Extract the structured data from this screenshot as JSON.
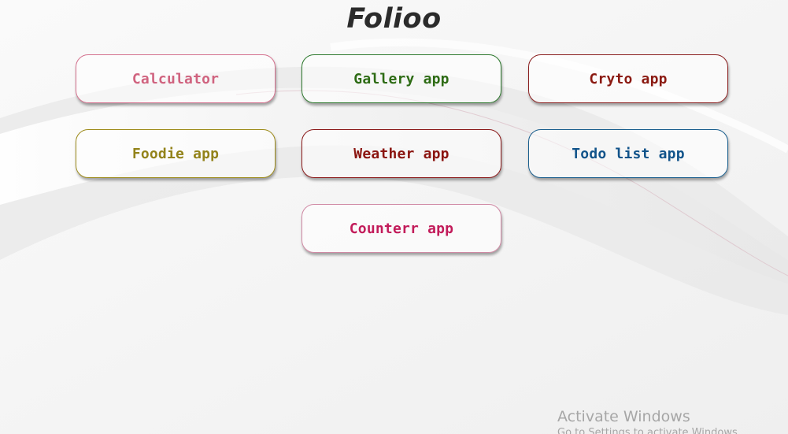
{
  "page": {
    "title": "Folioo"
  },
  "apps": [
    {
      "label": "Calculator",
      "color": "#d0637f"
    },
    {
      "label": "Gallery app",
      "color": "#2d6b14"
    },
    {
      "label": "Cryto app",
      "color": "#8b1a12"
    },
    {
      "label": "Foodie app",
      "color": "#93831a"
    },
    {
      "label": "Weather app",
      "color": "#8b1510"
    },
    {
      "label": "Todo list app",
      "color": "#11538a"
    },
    {
      "label": "Counterr app",
      "color": "#c21b5a"
    }
  ],
  "watermark": {
    "title": "Activate Windows",
    "subtitle": "Go to Settings to activate Windows."
  }
}
